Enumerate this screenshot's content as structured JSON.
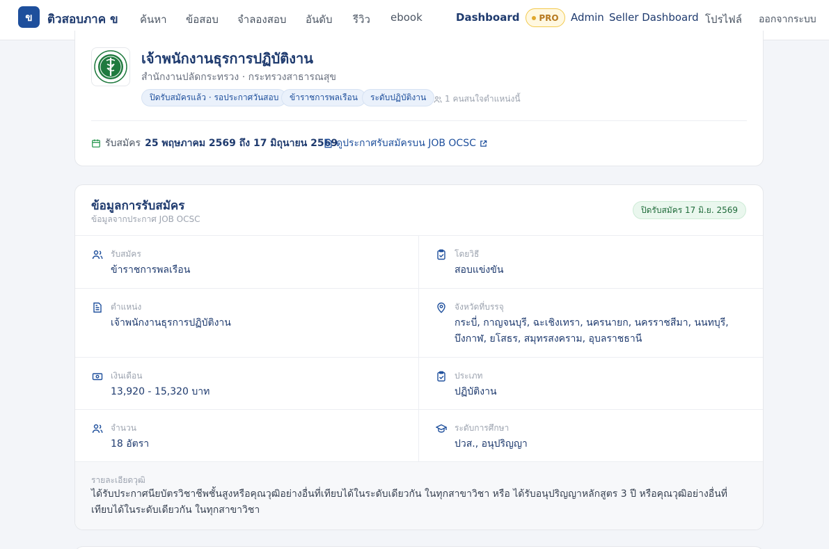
{
  "nav": {
    "logo_char": "ข",
    "brand": "ติวสอบภาค ข",
    "items": [
      "ค้นหา",
      "ข้อสอบ",
      "จำลองสอบ",
      "อันดับ",
      "รีวิว",
      "ebook"
    ],
    "dashboard": "Dashboard",
    "pro": "PRO",
    "admin": "Admin",
    "seller": "Seller Dashboard",
    "profile": "โปรไฟล์",
    "logout": "ออกจากระบบ"
  },
  "job": {
    "title": "เจ้าพนักงานธุรการปฏิบัติงาน",
    "agency": "สำนักงานปลัดกระทรวง · กระทรวงสาธารณสุข",
    "tags": [
      "ปิดรับสมัครแล้ว · รอประกาศวันสอบ",
      "ข้าราชการพลเรือน",
      "ระดับปฏิบัติงาน"
    ],
    "interest": "1 คนสนใจตำแหน่งนี้",
    "period_prefix": "รับสมัคร",
    "period_range": "25 พฤษภาคม 2569 ถึง 17 มิถุนายน 2569",
    "ocsc_link": "ดูประกาศรับสมัครบน JOB OCSC"
  },
  "application": {
    "title": "ข้อมูลการรับสมัคร",
    "subtitle": "ข้อมูลจากประกาศ JOB OCSC",
    "closed_badge": "ปิดรับสมัคร 17 มิ.ย. 2569",
    "fields": {
      "recruit_label": "รับสมัคร",
      "recruit_value": "ข้าราชการพลเรือน",
      "method_label": "โดยวิธี",
      "method_value": "สอบแข่งขัน",
      "position_label": "ตำแหน่ง",
      "position_value": "เจ้าพนักงานธุรการปฏิบัติงาน",
      "province_label": "จังหวัดที่บรรจุ",
      "province_value": "กระบี่, กาญจนบุรี, ฉะเชิงเทรา, นครนายก, นครราชสีมา, นนทบุรี, บึงกาฬ, ยโสธร, สมุทรสงคราม, อุบลราชธานี",
      "salary_label": "เงินเดือน",
      "salary_value": "13,920 - 15,320 บาท",
      "type_label": "ประเภท",
      "type_value": "ปฏิบัติงาน",
      "count_label": "จำนวน",
      "count_value": "18 อัตรา",
      "edu_label": "ระดับการศึกษา",
      "edu_value": "ปวส., อนุปริญญา"
    },
    "detail_label": "รายละเอียดวุฒิ",
    "detail_text": "ได้รับประกาศนียบัตรวิชาชีพชั้นสูงหรือคุณวุฒิอย่างอื่นที่เทียบได้ในระดับเดียวกัน ในทุกสาขาวิชา หรือ ได้รับอนุปริญญาหลักสูตร 3 ปี หรือคุณวุฒิอย่างอื่นที่เทียบได้ในระดับเดียวกัน ในทุกสาขาวิชา"
  },
  "colors": {
    "primary": "#1e4f9c",
    "heading": "#1e3a6e",
    "pro": "#e0a82e",
    "success": "#1f6b3a"
  }
}
